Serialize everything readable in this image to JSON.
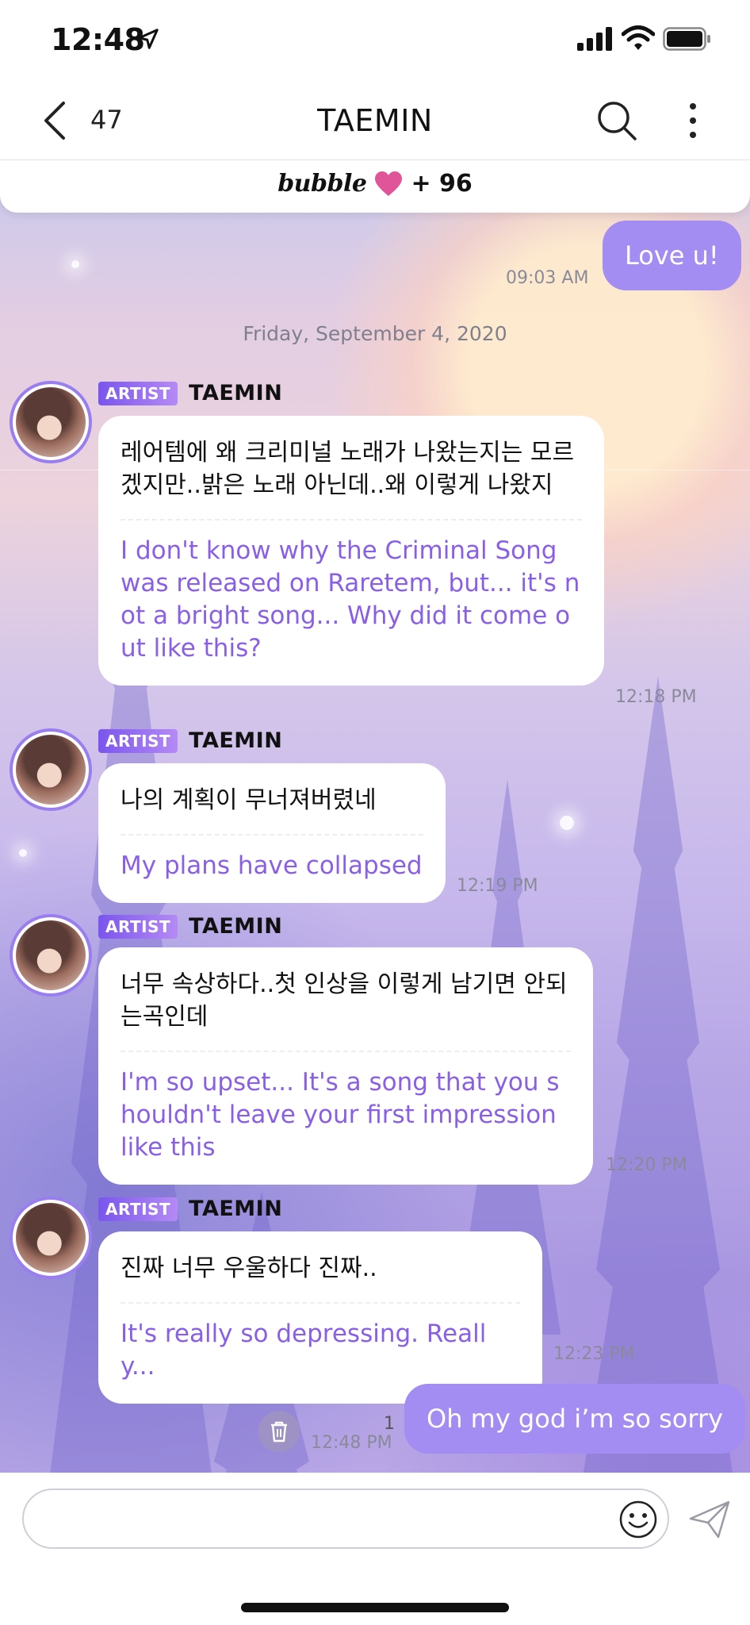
{
  "status_bar": {
    "time": "12:48"
  },
  "header": {
    "unread_count": "47",
    "title": "TAEMIN"
  },
  "banner": {
    "logo": "bubble",
    "count": "+ 96"
  },
  "messages": {
    "out1": {
      "text": "Love u!",
      "time": "09:03 AM"
    },
    "date_separator": "Friday, September 4, 2020",
    "in": [
      {
        "badge": "ARTIST",
        "name": "TAEMIN",
        "original": "레어템에 왜 크리미널 노래가 나왔는지는 모르겠지만..밝은 노래 아닌데..왜 이렇게 나왔지",
        "translation": "I don't know why the Criminal Song was released on Raretem, but... it's not  a bright song... Why did it come out like this?",
        "time": "12:18 PM"
      },
      {
        "badge": "ARTIST",
        "name": "TAEMIN",
        "original": "나의 계획이 무너져버렸네",
        "translation": "My plans have collapsed",
        "time": "12:19 PM"
      },
      {
        "badge": "ARTIST",
        "name": "TAEMIN",
        "original": "너무 속상하다..첫 인상을 이렇게 남기면 안되는곡인데",
        "translation": "I'm so upset... It's a song that you shouldn't leave your first impression like this",
        "time": "12:20 PM"
      },
      {
        "badge": "ARTIST",
        "name": "TAEMIN",
        "original": "진짜 너무 우울하다 진짜..",
        "translation": "It's really so depressing. Really...",
        "time": "12:23 PM"
      }
    ],
    "out2": {
      "text": "Oh my god i’m so sorry",
      "time": "12:48 PM",
      "read_count": "1"
    }
  },
  "input": {
    "placeholder": ""
  },
  "colors": {
    "accent": "#a38df3",
    "translation": "#8a5fe8",
    "badge": "#8a5cf0"
  }
}
